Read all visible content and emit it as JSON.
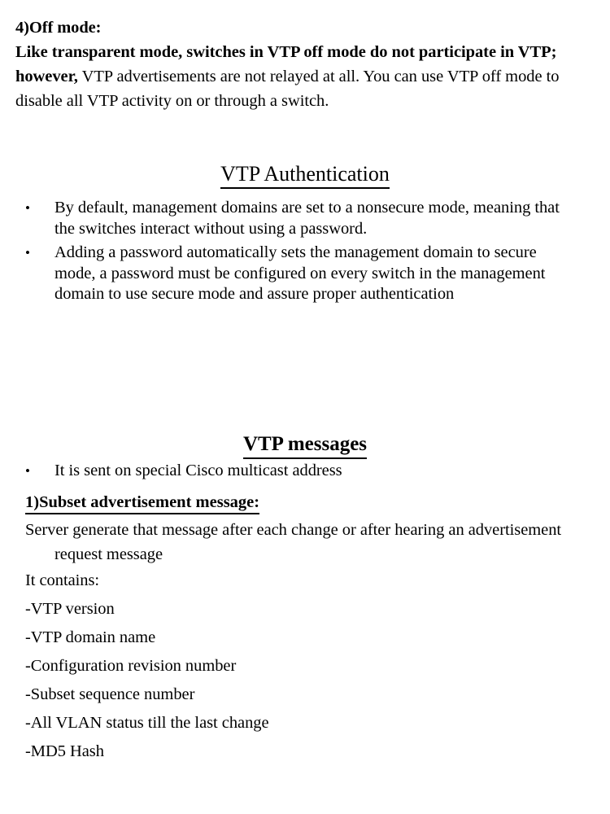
{
  "document": {
    "background_color": "#ffffff",
    "text_color": "#000000"
  },
  "off_mode_section": {
    "title": "4)Off mode:",
    "bold_lead": "Like transparent mode, switches in VTP off mode do not participate in VTP; however,",
    "body_rest": " VTP advertisements are not relayed at all. You can use VTP off mode to disable all VTP activity on or through a switch."
  },
  "authentication_section": {
    "heading": "VTP Authentication",
    "bullets": [
      "By default, management domains are set to a nonsecure mode, meaning that the switches interact without using a password.",
      "Adding a password automatically sets the management domain to secure mode, a password must be configured on every switch in the management domain to use secure mode and assure proper authentication"
    ]
  },
  "messages_section": {
    "heading": "VTP messages",
    "bullets": [
      "It is sent on special Cisco multicast address"
    ],
    "subheading": "1)Subset advertisement message:",
    "paragraph": "Server generate that message after each change or after hearing an advertisement request message",
    "contains_label": "It contains:",
    "contains_items": [
      "-VTP version",
      "-VTP domain name",
      "-Configuration revision number",
      "-Subset sequence number",
      "-All VLAN status till the last change",
      "-MD5 Hash"
    ]
  }
}
